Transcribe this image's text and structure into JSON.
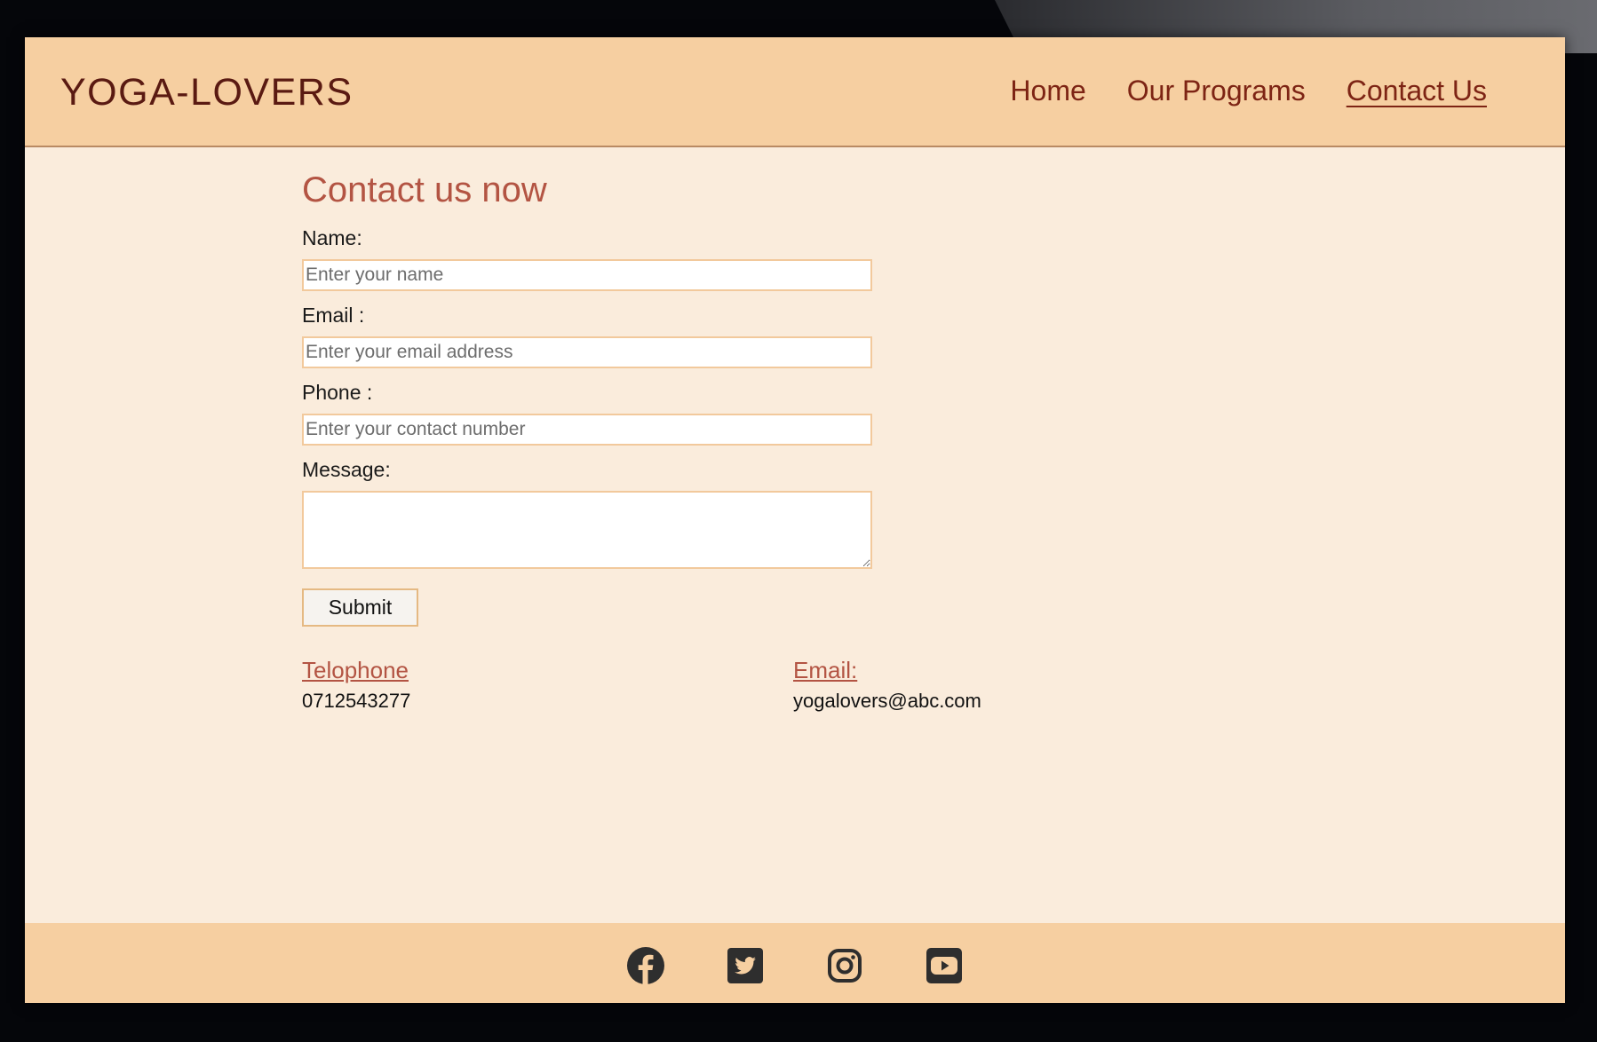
{
  "brand": "YOGA-LOVERS",
  "nav": {
    "home": "Home",
    "programs": "Our Programs",
    "contact": "Contact Us"
  },
  "form": {
    "title": "Contact us now",
    "name_label": "Name:",
    "name_placeholder": "Enter your name",
    "email_label": "Email :",
    "email_placeholder": "Enter your email address",
    "phone_label": "Phone :",
    "phone_placeholder": "Enter your contact number",
    "message_label": "Message:",
    "submit_label": "Submit"
  },
  "contact_info": {
    "telephone_heading": "Telophone",
    "telephone_value": "0712543277",
    "email_heading": "Email:",
    "email_value": "yogalovers@abc.com"
  },
  "footer": {
    "icons": [
      "facebook-icon",
      "twitter-icon",
      "instagram-icon",
      "youtube-icon"
    ]
  },
  "colors": {
    "header_bg": "#f6cfa1",
    "page_bg": "#faecdc",
    "accent": "#b35443",
    "brand_text": "#5a1a12"
  }
}
